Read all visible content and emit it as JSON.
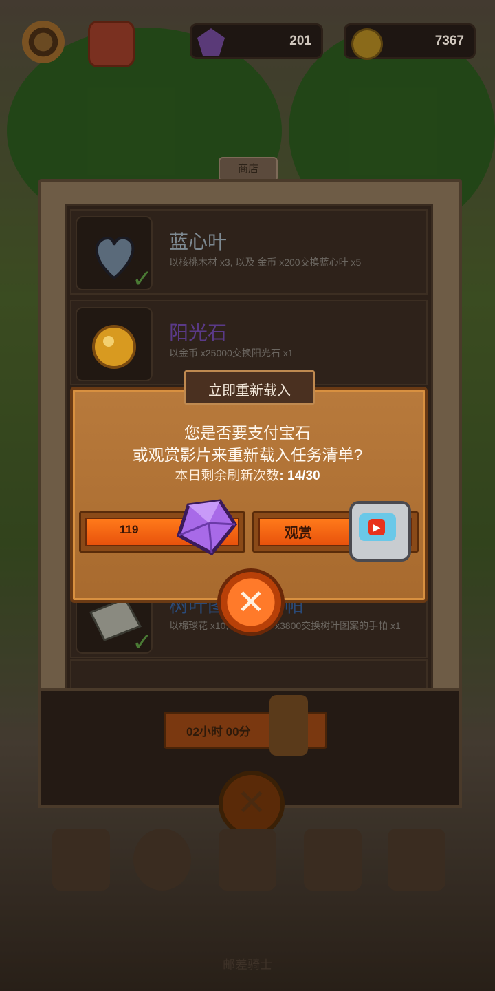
{
  "top_bar": {
    "gems": "201",
    "coins": "7367"
  },
  "shop": {
    "tab_label": "商店",
    "items": [
      {
        "name": "蓝心叶",
        "desc": "以核桃木材 x3, 以及 金币 x200交换蓝心叶 x5"
      },
      {
        "name": "阳光石",
        "desc": "以金币 x25000交换阳光石 x1"
      },
      {
        "name": "树叶图案的手帕",
        "desc": "以棉球花 x10, 以及 金币 x3800交换树叶图案的手帕 x1"
      }
    ],
    "timer": "02小时 00分"
  },
  "dialog": {
    "title": "立即重新载入",
    "question_line1": "您是否要支付宝石",
    "question_line2": "或观赏影片来重新载入任务清单?",
    "refresh_label": "本日剩余刷新次数",
    "refresh_value": ": 14/30",
    "gem_cost": "119",
    "watch_label": "观赏"
  },
  "bottom_label": "邮差骑士",
  "colors": {
    "accent_orange": "#ff7a1a",
    "dialog_wood": "#b87a3c",
    "panel_dark": "#2c2018"
  }
}
